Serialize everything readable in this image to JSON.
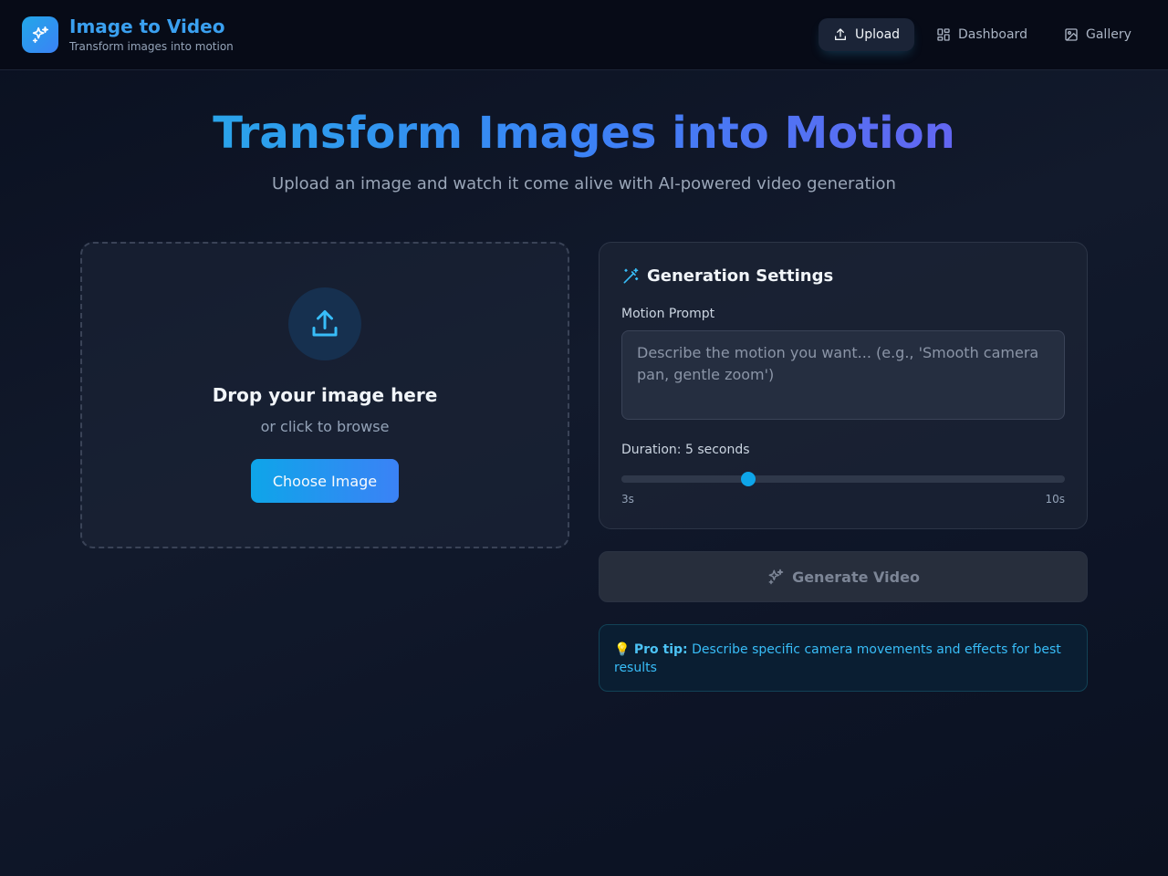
{
  "app": {
    "title": "Image to Video",
    "subtitle": "Transform images into motion"
  },
  "nav": {
    "items": [
      {
        "label": "Upload",
        "icon": "upload-icon",
        "active": true
      },
      {
        "label": "Dashboard",
        "icon": "dashboard-grid-icon",
        "active": false
      },
      {
        "label": "Gallery",
        "icon": "image-icon",
        "active": false
      }
    ]
  },
  "hero": {
    "title": "Transform Images into Motion",
    "subtitle": "Upload an image and watch it come alive with AI-powered video generation"
  },
  "dropzone": {
    "title": "Drop your image here",
    "subtitle": "or click to browse",
    "button_label": "Choose Image"
  },
  "settings": {
    "title": "Generation Settings",
    "prompt_label": "Motion Prompt",
    "prompt_placeholder": "Describe the motion you want... (e.g., 'Smooth camera pan, gentle zoom')",
    "prompt_value": "",
    "duration_label": "Duration: 5 seconds",
    "duration": {
      "min": 3,
      "max": 10,
      "value": 5
    },
    "min_label": "3s",
    "max_label": "10s"
  },
  "generate": {
    "label": "Generate Video",
    "disabled": true
  },
  "tip": {
    "emoji": "💡",
    "label": "Pro tip:",
    "text": "Describe specific camera movements and effects for best results"
  },
  "colors": {
    "accent": "#0ea5e9",
    "accent_blue": "#3b82f6",
    "accent_indigo": "#6366f1",
    "header_bg": "#070b17"
  }
}
